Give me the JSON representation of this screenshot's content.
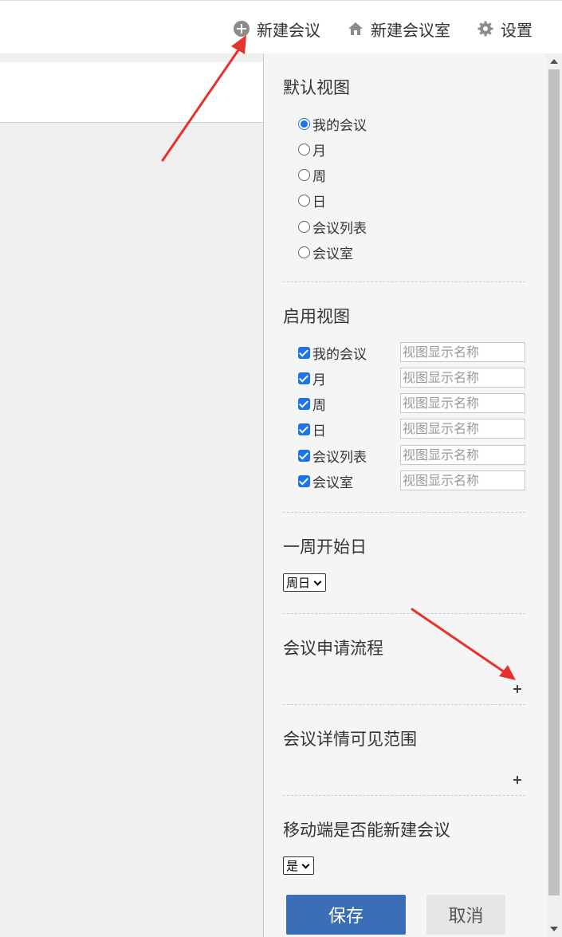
{
  "toolbar": {
    "new_meeting": "新建会议",
    "new_room": "新建会议室",
    "settings": "设置"
  },
  "default_view": {
    "title": "默认视图",
    "options": [
      "我的会议",
      "月",
      "周",
      "日",
      "会议列表",
      "会议室"
    ],
    "selected": "我的会议"
  },
  "enabled_views": {
    "title": "启用视图",
    "items": [
      {
        "label": "我的会议",
        "checked": true,
        "placeholder": "视图显示名称"
      },
      {
        "label": "月",
        "checked": true,
        "placeholder": "视图显示名称"
      },
      {
        "label": "周",
        "checked": true,
        "placeholder": "视图显示名称"
      },
      {
        "label": "日",
        "checked": true,
        "placeholder": "视图显示名称"
      },
      {
        "label": "会议列表",
        "checked": true,
        "placeholder": "视图显示名称"
      },
      {
        "label": "会议室",
        "checked": true,
        "placeholder": "视图显示名称"
      }
    ]
  },
  "week_start": {
    "title": "一周开始日",
    "value": "周日"
  },
  "approval_flow": {
    "title": "会议申请流程"
  },
  "visibility": {
    "title": "会议详情可见范围"
  },
  "mobile_create": {
    "title": "移动端是否能新建会议",
    "value": "是"
  },
  "actions": {
    "save": "保存",
    "cancel": "取消"
  },
  "colors": {
    "accent": "#1a73e8",
    "save_button": "#3a6fb8",
    "annotation_arrow": "#e8312c"
  },
  "icons": {
    "new_meeting": "plus-circle-icon",
    "new_room": "house-icon",
    "settings": "gear-icon"
  }
}
